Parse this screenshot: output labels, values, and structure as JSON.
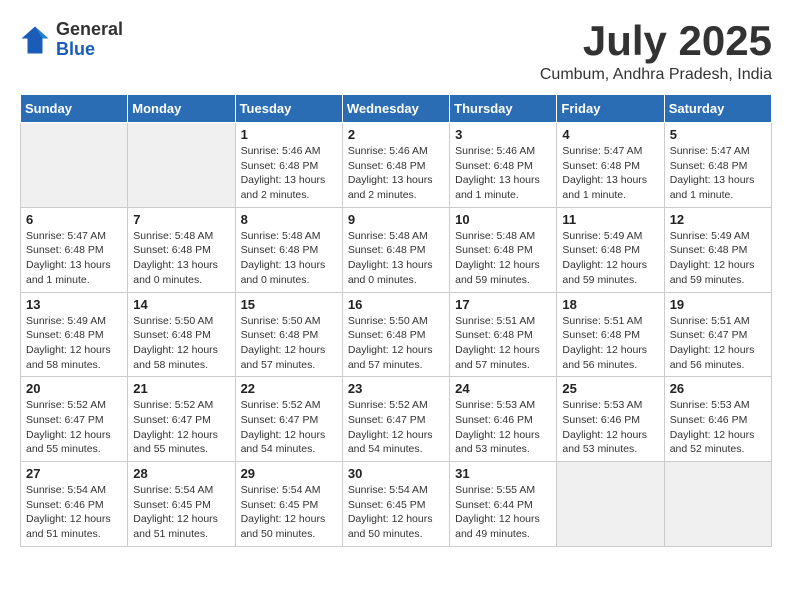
{
  "logo": {
    "general": "General",
    "blue": "Blue"
  },
  "title": "July 2025",
  "location": "Cumbum, Andhra Pradesh, India",
  "days_of_week": [
    "Sunday",
    "Monday",
    "Tuesday",
    "Wednesday",
    "Thursday",
    "Friday",
    "Saturday"
  ],
  "weeks": [
    [
      {
        "day": "",
        "info": ""
      },
      {
        "day": "",
        "info": ""
      },
      {
        "day": "1",
        "info": "Sunrise: 5:46 AM\nSunset: 6:48 PM\nDaylight: 13 hours and 2 minutes."
      },
      {
        "day": "2",
        "info": "Sunrise: 5:46 AM\nSunset: 6:48 PM\nDaylight: 13 hours and 2 minutes."
      },
      {
        "day": "3",
        "info": "Sunrise: 5:46 AM\nSunset: 6:48 PM\nDaylight: 13 hours and 1 minute."
      },
      {
        "day": "4",
        "info": "Sunrise: 5:47 AM\nSunset: 6:48 PM\nDaylight: 13 hours and 1 minute."
      },
      {
        "day": "5",
        "info": "Sunrise: 5:47 AM\nSunset: 6:48 PM\nDaylight: 13 hours and 1 minute."
      }
    ],
    [
      {
        "day": "6",
        "info": "Sunrise: 5:47 AM\nSunset: 6:48 PM\nDaylight: 13 hours and 1 minute."
      },
      {
        "day": "7",
        "info": "Sunrise: 5:48 AM\nSunset: 6:48 PM\nDaylight: 13 hours and 0 minutes."
      },
      {
        "day": "8",
        "info": "Sunrise: 5:48 AM\nSunset: 6:48 PM\nDaylight: 13 hours and 0 minutes."
      },
      {
        "day": "9",
        "info": "Sunrise: 5:48 AM\nSunset: 6:48 PM\nDaylight: 13 hours and 0 minutes."
      },
      {
        "day": "10",
        "info": "Sunrise: 5:48 AM\nSunset: 6:48 PM\nDaylight: 12 hours and 59 minutes."
      },
      {
        "day": "11",
        "info": "Sunrise: 5:49 AM\nSunset: 6:48 PM\nDaylight: 12 hours and 59 minutes."
      },
      {
        "day": "12",
        "info": "Sunrise: 5:49 AM\nSunset: 6:48 PM\nDaylight: 12 hours and 59 minutes."
      }
    ],
    [
      {
        "day": "13",
        "info": "Sunrise: 5:49 AM\nSunset: 6:48 PM\nDaylight: 12 hours and 58 minutes."
      },
      {
        "day": "14",
        "info": "Sunrise: 5:50 AM\nSunset: 6:48 PM\nDaylight: 12 hours and 58 minutes."
      },
      {
        "day": "15",
        "info": "Sunrise: 5:50 AM\nSunset: 6:48 PM\nDaylight: 12 hours and 57 minutes."
      },
      {
        "day": "16",
        "info": "Sunrise: 5:50 AM\nSunset: 6:48 PM\nDaylight: 12 hours and 57 minutes."
      },
      {
        "day": "17",
        "info": "Sunrise: 5:51 AM\nSunset: 6:48 PM\nDaylight: 12 hours and 57 minutes."
      },
      {
        "day": "18",
        "info": "Sunrise: 5:51 AM\nSunset: 6:48 PM\nDaylight: 12 hours and 56 minutes."
      },
      {
        "day": "19",
        "info": "Sunrise: 5:51 AM\nSunset: 6:47 PM\nDaylight: 12 hours and 56 minutes."
      }
    ],
    [
      {
        "day": "20",
        "info": "Sunrise: 5:52 AM\nSunset: 6:47 PM\nDaylight: 12 hours and 55 minutes."
      },
      {
        "day": "21",
        "info": "Sunrise: 5:52 AM\nSunset: 6:47 PM\nDaylight: 12 hours and 55 minutes."
      },
      {
        "day": "22",
        "info": "Sunrise: 5:52 AM\nSunset: 6:47 PM\nDaylight: 12 hours and 54 minutes."
      },
      {
        "day": "23",
        "info": "Sunrise: 5:52 AM\nSunset: 6:47 PM\nDaylight: 12 hours and 54 minutes."
      },
      {
        "day": "24",
        "info": "Sunrise: 5:53 AM\nSunset: 6:46 PM\nDaylight: 12 hours and 53 minutes."
      },
      {
        "day": "25",
        "info": "Sunrise: 5:53 AM\nSunset: 6:46 PM\nDaylight: 12 hours and 53 minutes."
      },
      {
        "day": "26",
        "info": "Sunrise: 5:53 AM\nSunset: 6:46 PM\nDaylight: 12 hours and 52 minutes."
      }
    ],
    [
      {
        "day": "27",
        "info": "Sunrise: 5:54 AM\nSunset: 6:46 PM\nDaylight: 12 hours and 51 minutes."
      },
      {
        "day": "28",
        "info": "Sunrise: 5:54 AM\nSunset: 6:45 PM\nDaylight: 12 hours and 51 minutes."
      },
      {
        "day": "29",
        "info": "Sunrise: 5:54 AM\nSunset: 6:45 PM\nDaylight: 12 hours and 50 minutes."
      },
      {
        "day": "30",
        "info": "Sunrise: 5:54 AM\nSunset: 6:45 PM\nDaylight: 12 hours and 50 minutes."
      },
      {
        "day": "31",
        "info": "Sunrise: 5:55 AM\nSunset: 6:44 PM\nDaylight: 12 hours and 49 minutes."
      },
      {
        "day": "",
        "info": ""
      },
      {
        "day": "",
        "info": ""
      }
    ]
  ]
}
